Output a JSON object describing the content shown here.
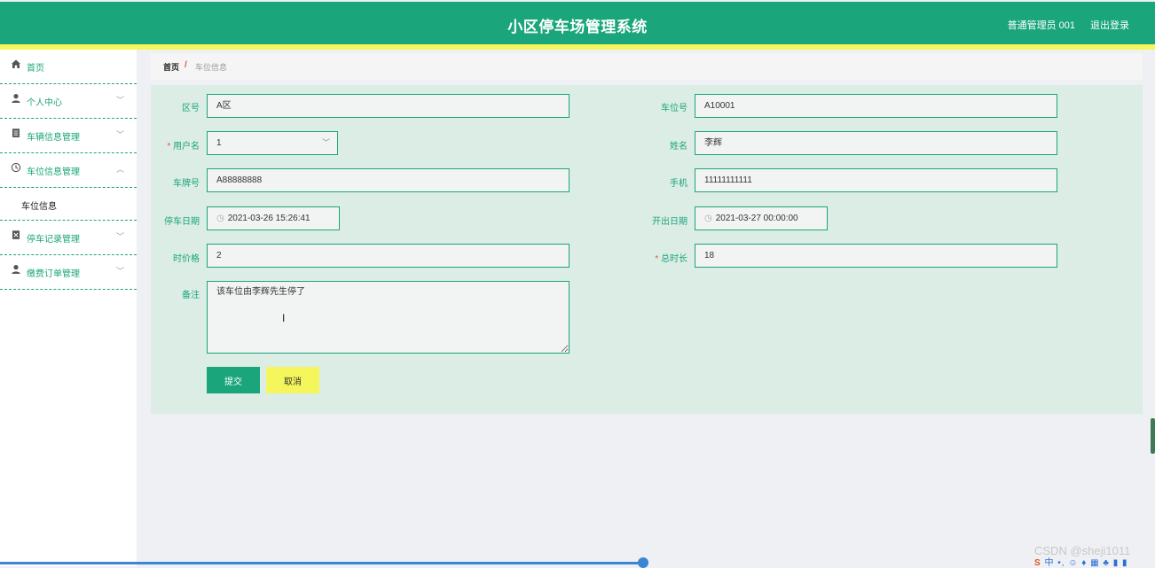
{
  "header": {
    "title": "小区停车场管理系统",
    "user": "普通管理员 001",
    "logout": "退出登录"
  },
  "sidebar": {
    "items": [
      {
        "label": "首页",
        "icon": "home-icon"
      },
      {
        "label": "个人中心",
        "icon": "user-icon",
        "arrow": "﹀"
      },
      {
        "label": "车辆信息管理",
        "icon": "document-icon",
        "arrow": "﹀"
      },
      {
        "label": "车位信息管理",
        "icon": "clock-icon",
        "arrow": "︿"
      },
      {
        "label": "停车记录管理",
        "icon": "list-icon",
        "arrow": "﹀"
      },
      {
        "label": "缴费订单管理",
        "icon": "user-icon",
        "arrow": "﹀"
      }
    ],
    "submenu": {
      "label": "车位信息"
    }
  },
  "breadcrumb": {
    "home": "首页",
    "separator": "/",
    "current": "车位信息"
  },
  "form": {
    "area": {
      "label": "区号",
      "value": "A区"
    },
    "space_no": {
      "label": "车位号",
      "value": "A10001"
    },
    "username": {
      "label": "用户名",
      "required_mark": "*",
      "value": "1"
    },
    "name": {
      "label": "姓名",
      "value": "李辉"
    },
    "plate": {
      "label": "车牌号",
      "value": "A88888888"
    },
    "phone": {
      "label": "手机",
      "value": "11111111111"
    },
    "park_date": {
      "label": "停车日期",
      "value": "2021-03-26 15:26:41"
    },
    "leave_date": {
      "label": "开出日期",
      "value": "2021-03-27 00:00:00"
    },
    "hourly_price": {
      "label": "时价格",
      "value": "2"
    },
    "total_hours": {
      "label": "总时长",
      "required_mark": "*",
      "value": "18"
    },
    "note": {
      "label": "备注",
      "value": "该车位由李辉先生停了"
    },
    "submit": "提交",
    "cancel": "取消"
  },
  "overlay": {
    "watermark": "CSDN @sheji1011",
    "tray": "中 •, ☺ ♦ ▦ ♣ ▮ ▮"
  },
  "colors": {
    "primary": "#1aa57a",
    "accent_yellow": "#f5f55c",
    "required": "#e05a3c",
    "form_bg": "#dcede6"
  }
}
